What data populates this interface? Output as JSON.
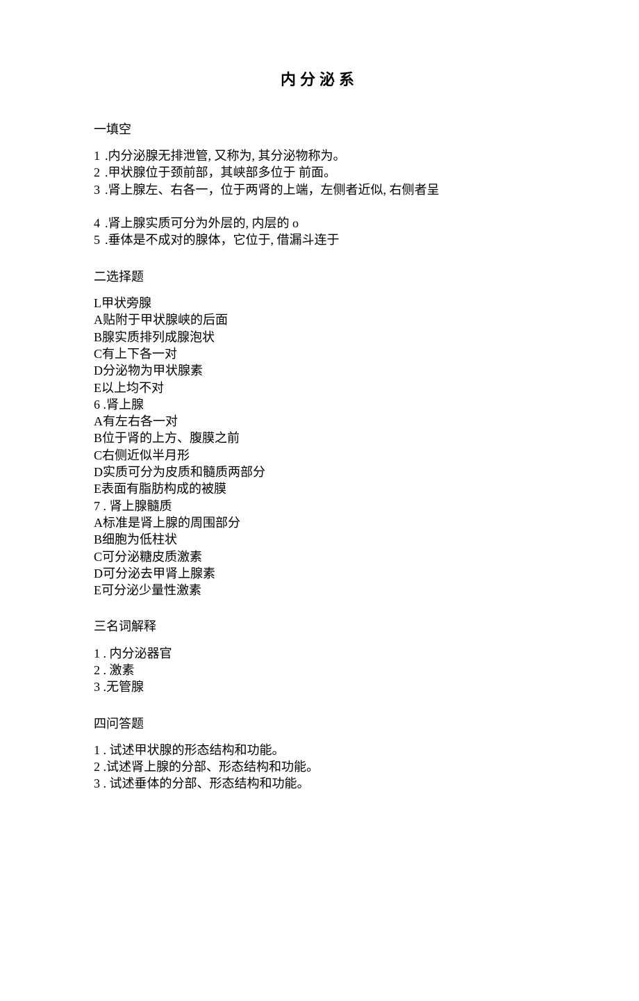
{
  "title": "内分泌系",
  "sections": {
    "fill": {
      "heading": "一填空",
      "items": [
        {
          "num": "1",
          "dot": " . ",
          "text": "内分泌腺无排泄管, 又称为, 其分泌物称为。"
        },
        {
          "num": "2",
          "dot": "  .",
          "text": "甲状腺位于颈前部，其峡部多位于  前面。"
        },
        {
          "num": "3",
          "dot": "  . ",
          "text": "肾上腺左、右各一，位于两肾的上端，左侧者近似, 右侧者呈"
        },
        {
          "num": "",
          "dot": "",
          "text": ""
        },
        {
          "num": "4",
          "dot": "  . ",
          "text": "肾上腺实质可分为外层的, 内层的  o"
        },
        {
          "num": "5",
          "dot": "  .",
          "text": "垂体是不成对的腺体，它位于, 借漏斗连于"
        }
      ]
    },
    "choice": {
      "heading": "二选择题",
      "groups": [
        {
          "stem_num": "L",
          "stem_text": "甲状旁腺",
          "options": [
            {
              "letter": "A",
              "text": "贴附于甲状腺峡的后面"
            },
            {
              "letter": "B",
              "text": "腺实质排列成腺泡状"
            },
            {
              "letter": "C",
              "text": "有上下各一对"
            },
            {
              "letter": "D",
              "text": "分泌物为甲状腺素"
            },
            {
              "letter": "E",
              "text": "以上均不对"
            }
          ]
        },
        {
          "stem_num": "6  .",
          "stem_text": "肾上腺",
          "options": [
            {
              "letter": "A",
              "text": "有左右各一对"
            },
            {
              "letter": "B",
              "text": "位于肾的上方、腹膜之前"
            },
            {
              "letter": "C",
              "text": "右侧近似半月形"
            },
            {
              "letter": "D",
              "text": "实质可分为皮质和髓质两部分"
            },
            {
              "letter": "E",
              "text": "表面有脂肪构成的被膜"
            }
          ]
        },
        {
          "stem_num": "7  . ",
          "stem_text": "肾上腺髓质",
          "options": [
            {
              "letter": "A",
              "text": "标准是肾上腺的周围部分"
            },
            {
              "letter": "B",
              "text": "细胞为低柱状"
            },
            {
              "letter": "C",
              "text": "可分泌糖皮质激素"
            },
            {
              "letter": "D",
              "text": "可分泌去甲肾上腺素"
            },
            {
              "letter": "E",
              "text": "可分泌少量性激素"
            }
          ]
        }
      ]
    },
    "terms": {
      "heading": "三名词解释",
      "items": [
        {
          "num": "1",
          "dot": "  . ",
          "text": "内分泌器官"
        },
        {
          "num": "2",
          "dot": "  . ",
          "text": "激素"
        },
        {
          "num": "3",
          "dot": "  .",
          "text": "无管腺"
        }
      ]
    },
    "qa": {
      "heading": "四问答题",
      "items": [
        {
          "num": "1",
          "dot": "  . ",
          "text": "试述甲状腺的形态结构和功能。"
        },
        {
          "num": "2",
          "dot": "  .",
          "text": "试述肾上腺的分部、形态结构和功能。"
        },
        {
          "num": "3",
          "dot": "  . ",
          "text": "试述垂体的分部、形态结构和功能。"
        }
      ]
    }
  }
}
